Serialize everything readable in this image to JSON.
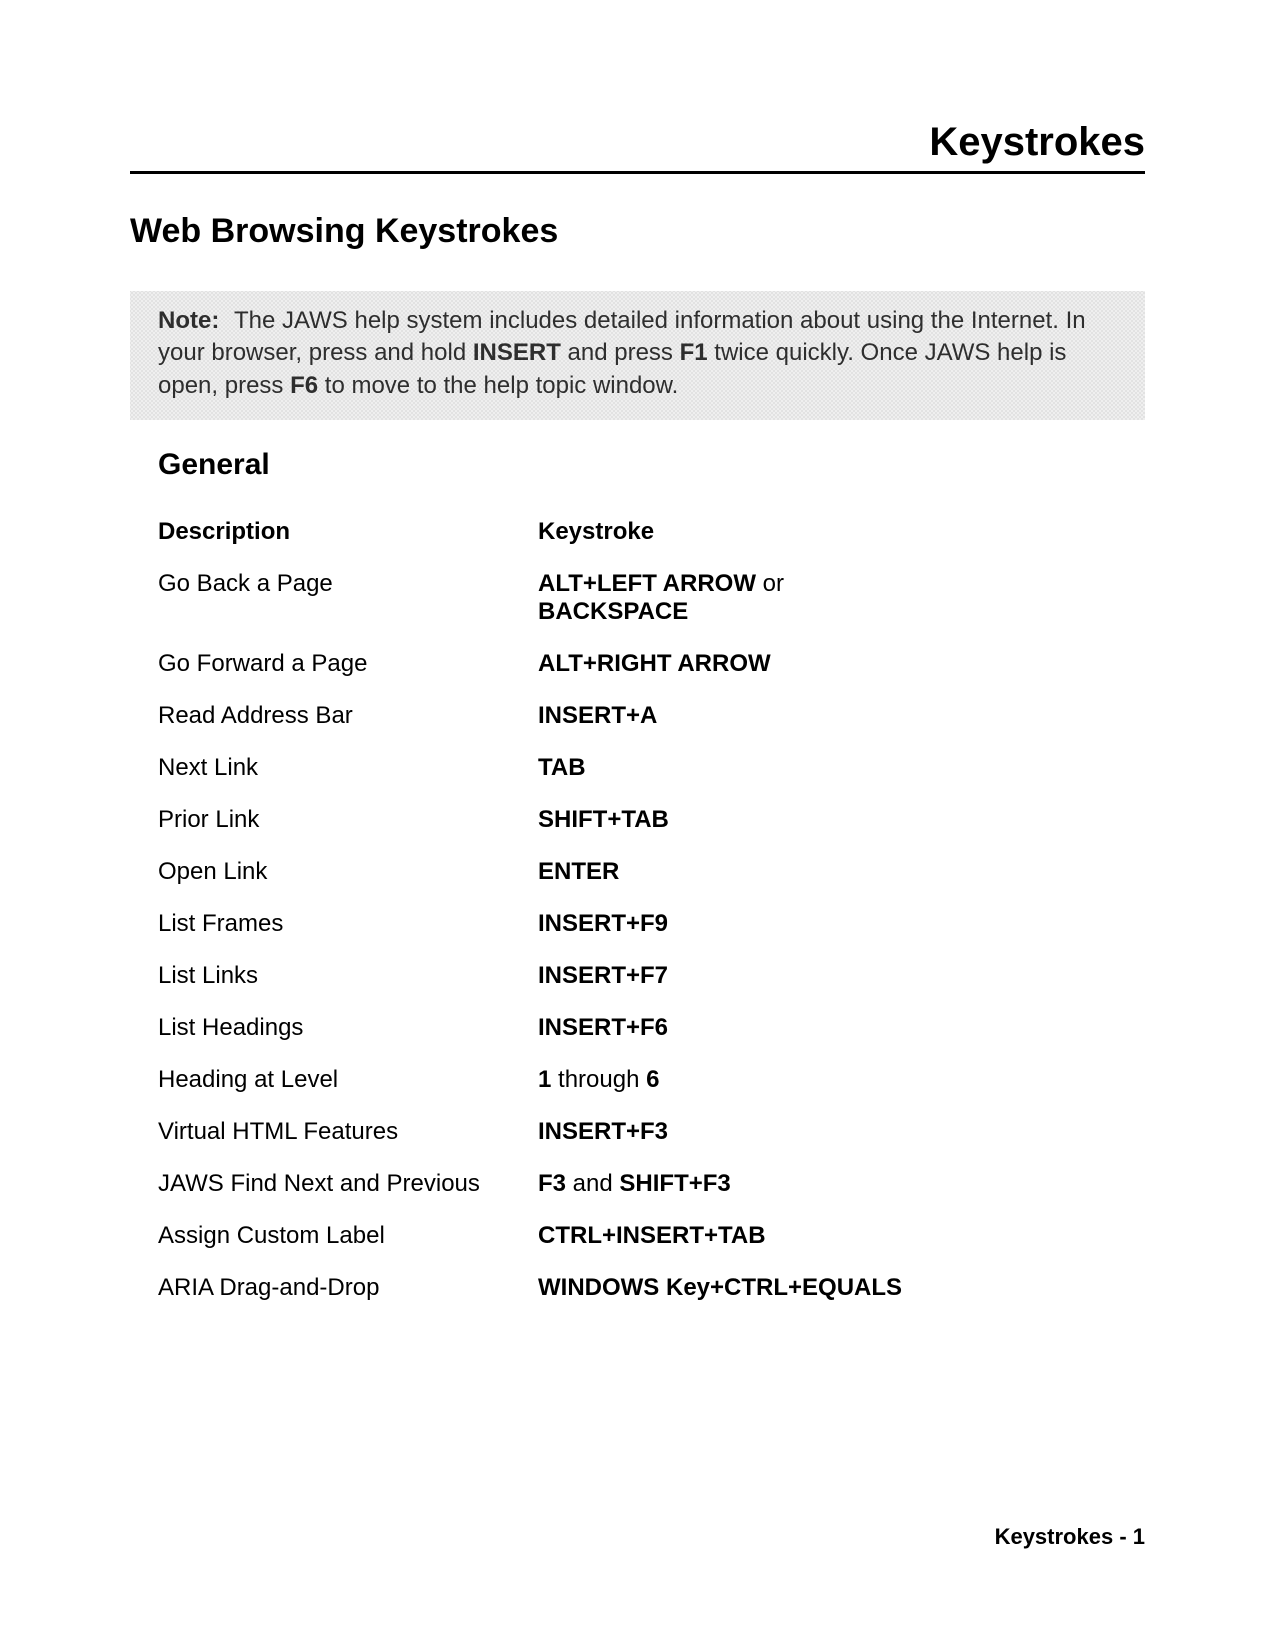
{
  "header": {
    "title": "Keystrokes"
  },
  "section": {
    "title": "Web Browsing Keystrokes"
  },
  "note": {
    "label": "Note:",
    "pre": "The JAWS help system includes detailed information about using the Internet. In your browser, press and hold ",
    "insert": "INSERT",
    "mid1": " and press ",
    "f1": "F1",
    "mid2": " twice quickly. Once JAWS help is open, press ",
    "f6": "F6",
    "post": " to move to the help topic window."
  },
  "subsection": {
    "title": "General"
  },
  "table": {
    "head": {
      "desc": "Description",
      "key": "Keystroke"
    },
    "rows": [
      {
        "desc": "Go Back a Page",
        "key": [
          {
            "t": "ALT+LEFT ARROW",
            "b": true
          },
          {
            "t": " or ",
            "b": false
          },
          {
            "t": "BACKSPACE",
            "b": true
          }
        ]
      },
      {
        "desc": "Go Forward a Page",
        "key": [
          {
            "t": "ALT+RIGHT ARROW",
            "b": true
          }
        ]
      },
      {
        "desc": "Read Address Bar",
        "key": [
          {
            "t": "INSERT+A",
            "b": true
          }
        ]
      },
      {
        "desc": "Next Link",
        "key": [
          {
            "t": "TAB",
            "b": true
          }
        ]
      },
      {
        "desc": "Prior Link",
        "key": [
          {
            "t": "SHIFT+TAB",
            "b": true
          }
        ]
      },
      {
        "desc": "Open Link",
        "key": [
          {
            "t": "ENTER",
            "b": true
          }
        ]
      },
      {
        "desc": "List Frames",
        "key": [
          {
            "t": "INSERT+F9",
            "b": true
          }
        ]
      },
      {
        "desc": "List Links",
        "key": [
          {
            "t": "INSERT+F7",
            "b": true
          }
        ]
      },
      {
        "desc": "List Headings",
        "key": [
          {
            "t": "INSERT+F6",
            "b": true
          }
        ]
      },
      {
        "desc": "Heading at Level",
        "key": [
          {
            "t": "1",
            "b": true
          },
          {
            "t": " through ",
            "b": false
          },
          {
            "t": "6",
            "b": true
          }
        ]
      },
      {
        "desc": "Virtual HTML Features",
        "key": [
          {
            "t": "INSERT+F3",
            "b": true
          }
        ]
      },
      {
        "desc": "JAWS Find Next and Previous",
        "key": [
          {
            "t": "F3",
            "b": true
          },
          {
            "t": " and ",
            "b": false
          },
          {
            "t": "SHIFT+F3",
            "b": true
          }
        ]
      },
      {
        "desc": "Assign Custom Label",
        "key": [
          {
            "t": "CTRL+INSERT+TAB",
            "b": true
          }
        ]
      },
      {
        "desc": "ARIA Drag-and-Drop",
        "key": [
          {
            "t": "WINDOWS Key+CTRL+EQUALS",
            "b": true
          }
        ]
      }
    ]
  },
  "footer": {
    "text": "Keystrokes - 1"
  }
}
